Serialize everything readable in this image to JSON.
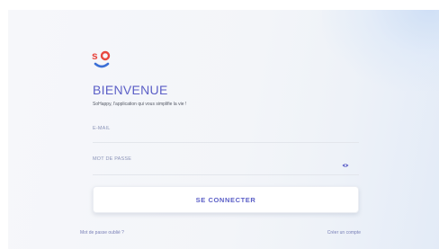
{
  "app": {
    "logo": "so-logo",
    "title": "BIENVENUE",
    "subtitle": "SoHappy, l'application qui vous simplifie la vie !"
  },
  "form": {
    "email": {
      "label": "E-MAIL",
      "value": "",
      "placeholder": ""
    },
    "password": {
      "label": "MOT DE PASSE",
      "value": "",
      "placeholder": "",
      "toggle_icon": "eye-icon"
    },
    "submit_label": "SE CONNECTER"
  },
  "links": {
    "forgot_password": "Mot de passe oublié ?",
    "create_account": "Créer un compte"
  },
  "colors": {
    "accent": "#5b5fc7",
    "logo_red": "#e8473f",
    "logo_blue": "#3b6fd6",
    "label": "#8a93b8"
  }
}
